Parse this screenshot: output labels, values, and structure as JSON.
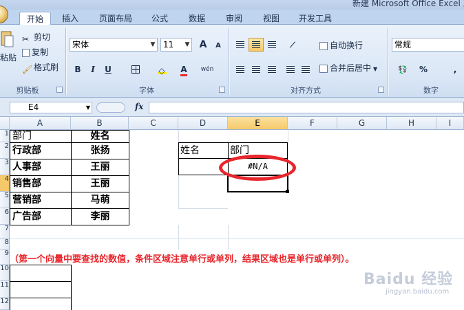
{
  "window": {
    "title": "新建 Microsoft Office Excel 工"
  },
  "tabs": [
    {
      "label": "开始",
      "active": true
    },
    {
      "label": "插入"
    },
    {
      "label": "页面布局"
    },
    {
      "label": "公式"
    },
    {
      "label": "数据"
    },
    {
      "label": "审阅"
    },
    {
      "label": "视图"
    },
    {
      "label": "开发工具"
    }
  ],
  "clipboard": {
    "paste": "粘贴",
    "cut": "剪切",
    "copy": "复制",
    "format_painter": "格式刷",
    "group": "剪贴板"
  },
  "font": {
    "name": "宋体",
    "size": "11",
    "group": "字体",
    "bold": "B",
    "italic": "I",
    "underline": "U",
    "grow": "A",
    "shrink": "A",
    "color_letter": "A",
    "phonetic": "wén"
  },
  "alignment": {
    "wrap": "自动换行",
    "merge": "合并后居中",
    "group": "对齐方式"
  },
  "number": {
    "format": "常规",
    "group": "数字",
    "percent": "%",
    "comma": ","
  },
  "formula_bar": {
    "cell_ref": "E4",
    "fx": "fx",
    "formula": ""
  },
  "columns": [
    "A",
    "B",
    "C",
    "D",
    "E",
    "F",
    "G",
    "H",
    "I"
  ],
  "selected_column": "E",
  "rows": [
    "1",
    "2",
    "3",
    "4",
    "5",
    "6",
    "7",
    "8",
    "9",
    "10",
    "11",
    "12"
  ],
  "table": {
    "headers": [
      "部门",
      "姓名"
    ],
    "rows": [
      [
        "行政部",
        "张扬"
      ],
      [
        "人事部",
        "王丽"
      ],
      [
        "销售部",
        "王丽"
      ],
      [
        "营销部",
        "马萌"
      ],
      [
        "广告部",
        "李丽"
      ]
    ]
  },
  "lookup": {
    "header_name": "姓名",
    "header_dept": "部门",
    "result": "#N/A"
  },
  "note": "（第一个向量中要查找的数值，条件区域注意单行或单列，结果区域也是单行或单列）。",
  "colors": {
    "annotation_red": "#e8262c",
    "ribbon_blue": "#dbe7f6",
    "selected_header": "#f5c96a"
  },
  "watermark": {
    "brand": "Baidu 经验",
    "url": "jingyan.baidu.com"
  }
}
